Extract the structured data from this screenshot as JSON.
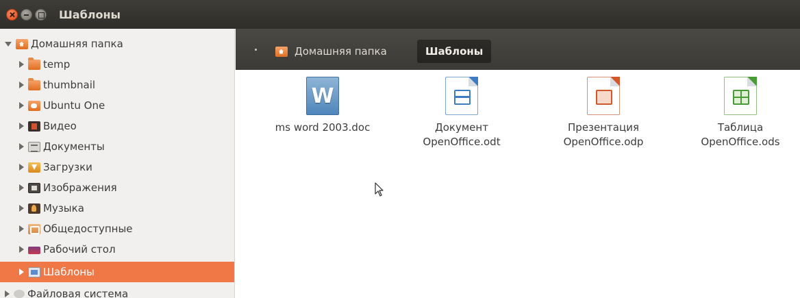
{
  "window": {
    "title": "Шаблоны"
  },
  "sidebar": {
    "items": [
      {
        "label": "Домашняя папка",
        "icon": "home-folder-icon",
        "expanded": true
      },
      {
        "label": "temp",
        "icon": "folder-icon"
      },
      {
        "label": "thumbnail",
        "icon": "folder-icon"
      },
      {
        "label": "Ubuntu One",
        "icon": "ubuntu-one-folder-icon"
      },
      {
        "label": "Видео",
        "icon": "video-folder-icon"
      },
      {
        "label": "Документы",
        "icon": "documents-folder-icon"
      },
      {
        "label": "Загрузки",
        "icon": "downloads-folder-icon"
      },
      {
        "label": "Изображения",
        "icon": "pictures-folder-icon"
      },
      {
        "label": "Музыка",
        "icon": "music-folder-icon"
      },
      {
        "label": "Общедоступные",
        "icon": "public-folder-icon"
      },
      {
        "label": "Рабочий стол",
        "icon": "desktop-folder-icon"
      },
      {
        "label": "Шаблоны",
        "icon": "templates-folder-icon",
        "selected": true
      },
      {
        "label": "Файловая система",
        "icon": "filesystem-icon"
      }
    ]
  },
  "breadcrumb": {
    "home_label": "Домашняя папка",
    "current_label": "Шаблоны"
  },
  "files": [
    {
      "name": "ms word 2003.doc",
      "icon": "word-document-icon",
      "glyph": "W"
    },
    {
      "name": "Документ\nOpenOffice.odt",
      "icon": "odt-document-icon"
    },
    {
      "name": "Презентация\nOpenOffice.odp",
      "icon": "odp-presentation-icon"
    },
    {
      "name": "Таблица\nOpenOffice.ods",
      "icon": "ods-spreadsheet-icon"
    }
  ],
  "colors": {
    "selection": "#f07746",
    "titlebar": "#3d3c37",
    "toolbar": "#4a4944"
  }
}
